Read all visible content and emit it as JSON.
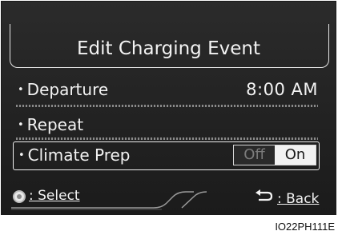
{
  "screen": {
    "title": "Edit Charging Event",
    "rows": {
      "departure": {
        "label": "Departure",
        "value": "8:00 AM"
      },
      "repeat": {
        "label": "Repeat"
      },
      "climate": {
        "label": "Climate Prep",
        "off_label": "Off",
        "on_label": "On",
        "selected": "On"
      }
    },
    "bullet": "•",
    "footer": {
      "select_label": ": Select",
      "back_label": ": Back"
    }
  },
  "caption": "IO22PH111E",
  "colors": {
    "background": "#1f1f1f",
    "text": "#f3f3f3",
    "toggle_on_bg": "#f2f2f2",
    "toggle_off_text": "#7b7b7b"
  },
  "icons": [
    "select-knob-icon",
    "back-arrow-icon"
  ]
}
